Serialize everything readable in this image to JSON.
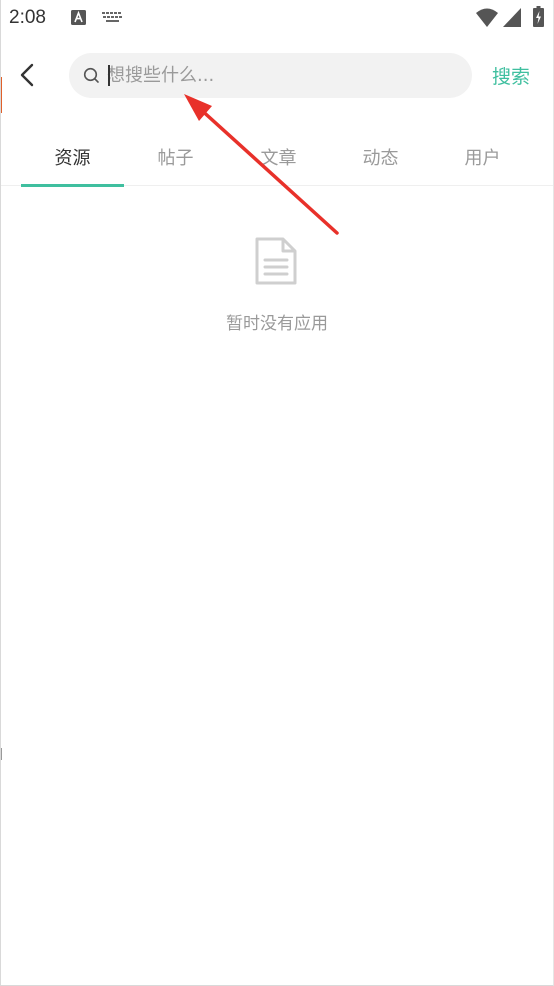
{
  "status_bar": {
    "time": "2:08",
    "icons": [
      "a-notification-icon",
      "keyboard-icon",
      "wifi-icon",
      "signal-icon",
      "battery-charging-icon"
    ]
  },
  "header": {
    "back_icon": "chevron-left-icon",
    "search": {
      "placeholder": "想搜些什么...",
      "value": "",
      "icon": "search-icon"
    },
    "search_button_label": "搜索"
  },
  "tabs": [
    {
      "label": "资源",
      "active": true
    },
    {
      "label": "帖子",
      "active": false
    },
    {
      "label": "文章",
      "active": false
    },
    {
      "label": "动态",
      "active": false
    },
    {
      "label": "用户",
      "active": false
    }
  ],
  "empty_state": {
    "icon": "document-icon",
    "message": "暂时没有应用"
  },
  "colors": {
    "accent": "#3fbf9f",
    "annotation_arrow": "#e8312a",
    "muted_text": "#9a9a9a",
    "search_bg": "#f2f2f2"
  }
}
